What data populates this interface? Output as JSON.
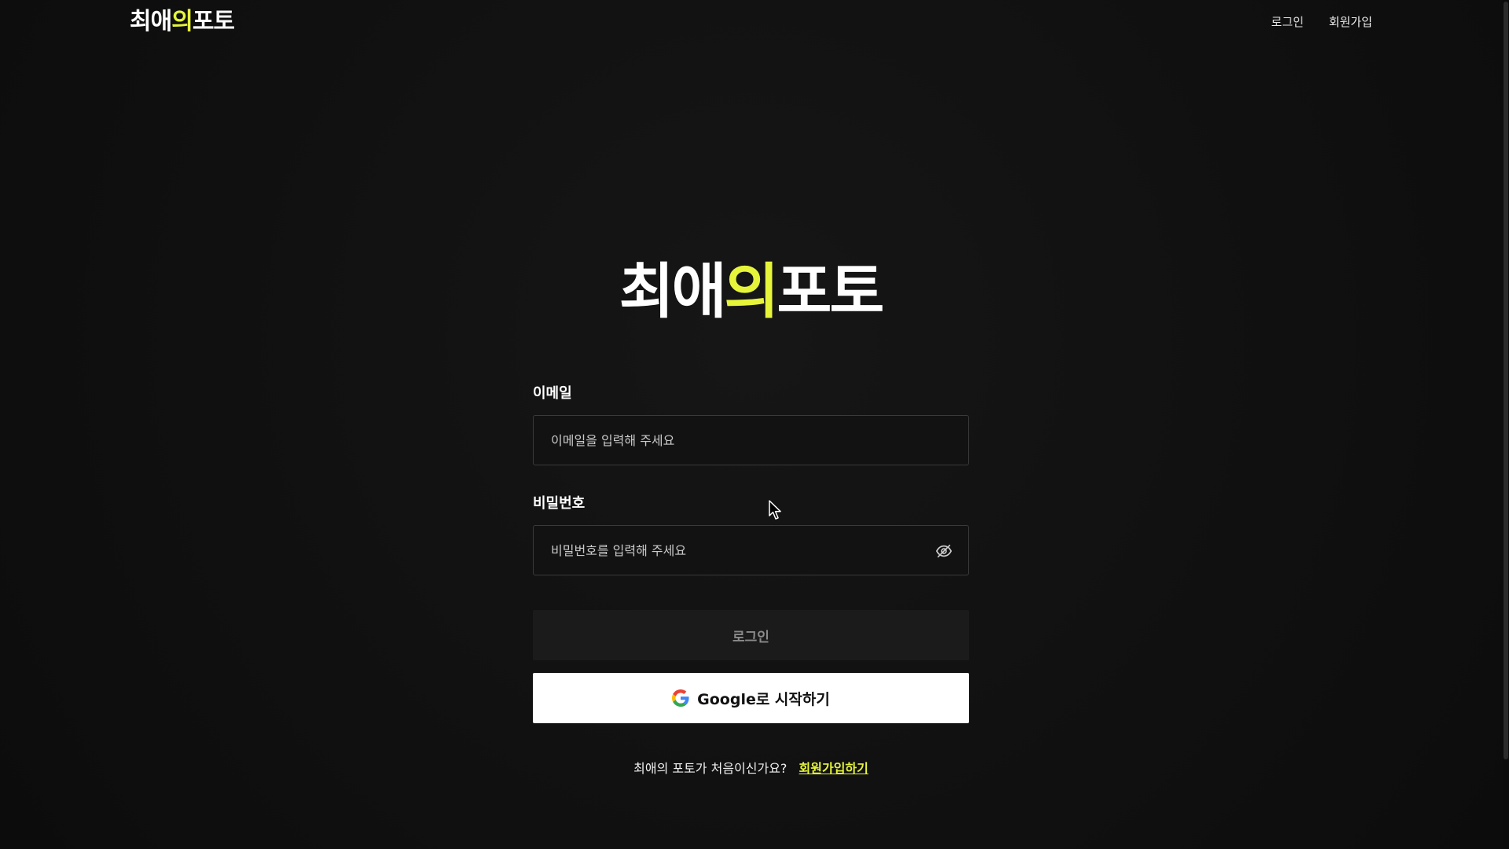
{
  "brand": {
    "part1": "최애",
    "accent": "의",
    "part2": "포토",
    "accent_color": "#e6f53a"
  },
  "nav": {
    "login": "로그인",
    "signup": "회원가입"
  },
  "form": {
    "email_label": "이메일",
    "email_placeholder": "이메일을 입력해 주세요",
    "email_value": "",
    "password_label": "비밀번호",
    "password_placeholder": "비밀번호를 입력해 주세요",
    "password_value": "",
    "password_toggle_icon": "eye-off-icon",
    "login_button": "로그인",
    "google_button": "Google로 시작하기",
    "google_icon": "google-icon"
  },
  "footer": {
    "prompt": "최애의 포토가 처음이신가요?",
    "signup_link": "회원가입하기"
  }
}
